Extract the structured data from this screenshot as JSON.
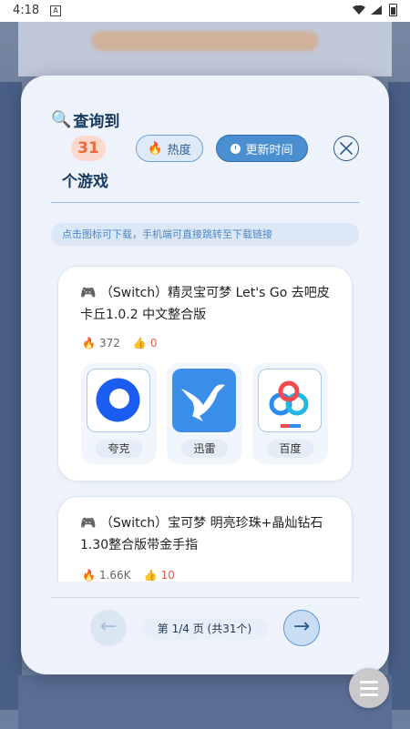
{
  "status_bar": {
    "time": "4:18",
    "notif_glyph": "A"
  },
  "header": {
    "title": "查询到",
    "count": "31",
    "count_suffix": "个游戏"
  },
  "sort": {
    "hot_label": "热度",
    "time_label": "更新时间",
    "active": "time"
  },
  "hint": "点击图标可下载，手机端可直接跳转至下载链接",
  "games": [
    {
      "title": "🎮 （Switch）精灵宝可梦 Let's Go 去吧皮卡丘1.0.2 中文整合版",
      "heat": "372",
      "likes": "0",
      "downloads": [
        {
          "label": "夸克",
          "icon": "quark-icon"
        },
        {
          "label": "迅雷",
          "icon": "xunlei-icon"
        },
        {
          "label": "百度",
          "icon": "baidu-icon"
        }
      ]
    },
    {
      "title": "🎮 （Switch）宝可梦 明亮珍珠+晶灿钻石 1.30整合版带金手指",
      "heat": "1.66K",
      "likes": "10"
    }
  ],
  "pager": {
    "prev": "←",
    "next": "→",
    "info": "第 1/4 页 (共31个)"
  },
  "colors": {
    "accent": "#4a8fd0",
    "count_text": "#e96a3a",
    "like": "#e25b4b"
  }
}
